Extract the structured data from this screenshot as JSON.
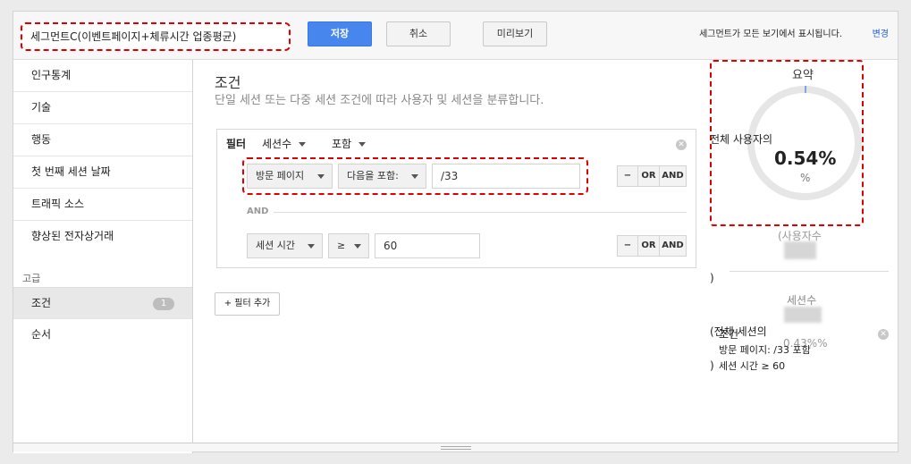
{
  "header": {
    "segment_name": "세그먼트C(이벤트페이지+체류시간 업종평균)",
    "save_label": "저장",
    "cancel_label": "취소",
    "preview_label": "미리보기",
    "visibility_note": "세그먼트가 모든 보기에서 표시됩니다.",
    "change_link": "변경"
  },
  "sidebar": {
    "items": [
      {
        "label": "인구통계"
      },
      {
        "label": "기술"
      },
      {
        "label": "행동"
      },
      {
        "label": "첫 번째 세션 날짜"
      },
      {
        "label": "트래픽 소스"
      },
      {
        "label": "향상된 전자상거래"
      }
    ],
    "advanced_heading": "고급",
    "advanced_items": [
      {
        "label": "조건",
        "badge": "1"
      },
      {
        "label": "순서"
      }
    ]
  },
  "main": {
    "title": "조건",
    "subtitle": "단일 세션 또는 다중 세션 조건에 따라 사용자 및 세션을 분류합니다.",
    "filter": {
      "label": "필터",
      "scope": "세션수",
      "mode": "포함",
      "conditions": [
        {
          "dimension": "방문 페이지",
          "operator": "다음을 포함:",
          "value": "/33"
        },
        {
          "dimension": "세션 시간",
          "operator": "≥",
          "value": "60"
        }
      ],
      "and_label": "AND",
      "op_buttons": {
        "minus": "−",
        "or": "OR",
        "and": "AND"
      }
    },
    "add_filter_label": "+ 필터 추가"
  },
  "summary": {
    "title": "요약",
    "ratio_label": "전체 사용자의",
    "ratio_value": "0.54%",
    "ratio_unit": "%",
    "ratio_fraction": 0.0054,
    "users_label": "(사용자수",
    "sessions_label": "세션수",
    "sessions_ratio_label": "(전체 세션의",
    "sessions_ratio_value": "0.43%%",
    "close_paren": ")",
    "condition_title": "조건",
    "condition_row1": "방문 페이지: /33 포함",
    "condition_row2": "세션 시간 ≥ 60"
  },
  "colors": {
    "primary_button": "#4787ed",
    "highlight": "#e00000",
    "link": "#1a5fcc"
  }
}
